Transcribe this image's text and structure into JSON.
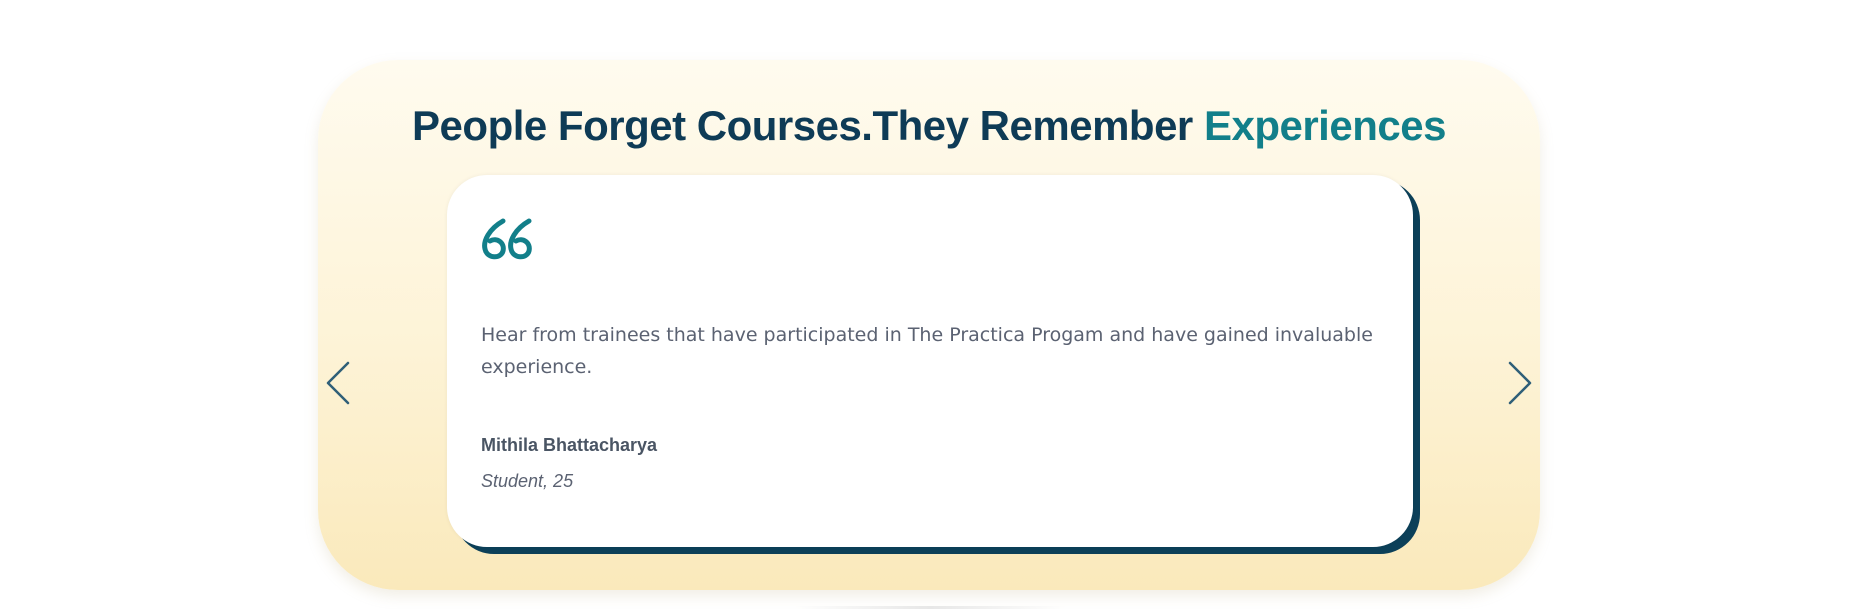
{
  "heading": {
    "main": "People Forget Courses.They Remember ",
    "accent": "Experiences"
  },
  "testimonial": {
    "quote_icon": "quote-open-icon",
    "text": "Hear from trainees that have participated in The Practica Progam and have gained invaluable experience.",
    "author": "Mithila Bhattacharya",
    "role": "Student, 25"
  },
  "navigation": {
    "prev_icon": "chevron-left-icon",
    "next_icon": "chevron-right-icon"
  },
  "colors": {
    "heading": "#0e3b56",
    "accent": "#127f8a",
    "card_shadow": "#0c4059",
    "panel_top": "#fffbef",
    "panel_bottom": "#fae9bb",
    "body_text": "#5b6272"
  }
}
